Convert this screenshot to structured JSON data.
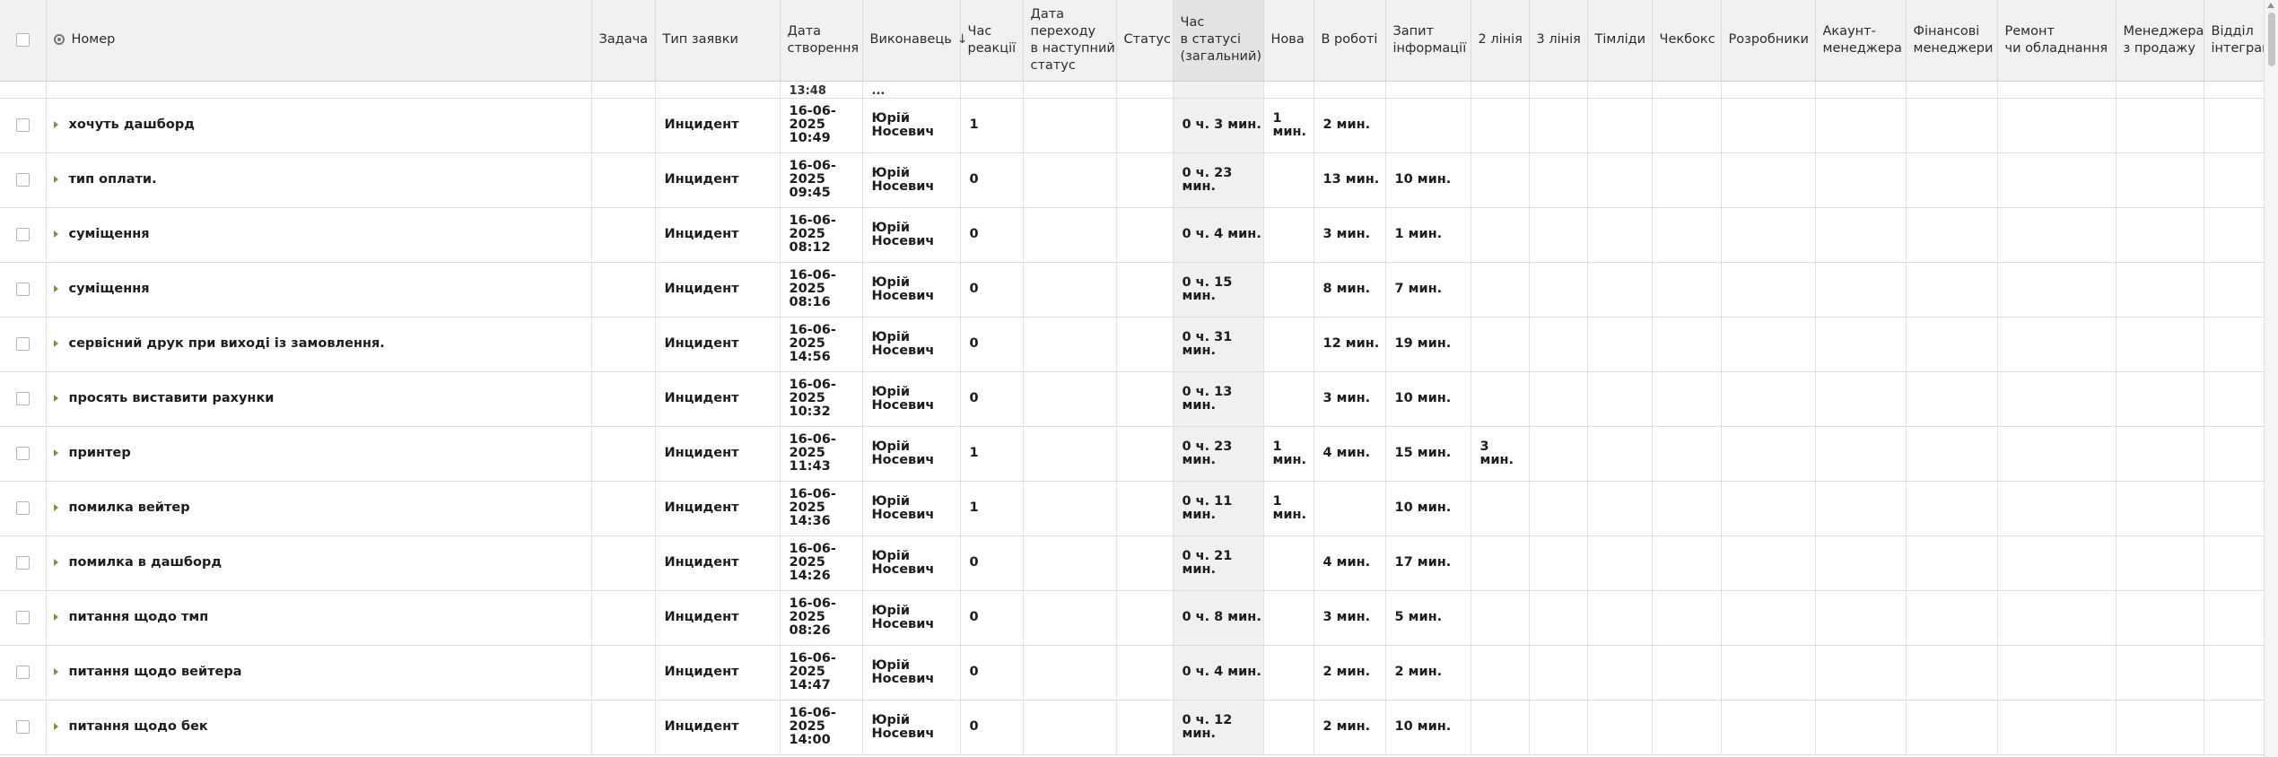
{
  "columns": [
    {
      "key": "number",
      "label": "Номер"
    },
    {
      "key": "task",
      "label": "Задача"
    },
    {
      "key": "type",
      "label": "Тип заявки"
    },
    {
      "key": "created",
      "label": "Дата\nстворення"
    },
    {
      "key": "assignee",
      "label": "Виконавець"
    },
    {
      "key": "reaction",
      "label": "Час\nреакції"
    },
    {
      "key": "next_status_date",
      "label": "Дата\nпереходу\nв наступний\nстатус"
    },
    {
      "key": "status",
      "label": "Статус"
    },
    {
      "key": "time_in_status",
      "label": "Час\nв статусі\n(загальний)"
    },
    {
      "key": "new",
      "label": "Нова"
    },
    {
      "key": "in_work",
      "label": "В роботі"
    },
    {
      "key": "info_request",
      "label": "Запит\nінформації"
    },
    {
      "key": "line2",
      "label": "2 лінія"
    },
    {
      "key": "line3",
      "label": "3 лінія"
    },
    {
      "key": "teamlead",
      "label": "Тімліди"
    },
    {
      "key": "checkbox",
      "label": "Чекбокс"
    },
    {
      "key": "developers",
      "label": "Розробники"
    },
    {
      "key": "account_managers",
      "label": "Акаунт-\nменеджера"
    },
    {
      "key": "finance_managers",
      "label": "Фінансові\nменеджери"
    },
    {
      "key": "repair",
      "label": "Ремонт\nчи обладнання"
    },
    {
      "key": "sales_managers",
      "label": "Менеджера\nз продажу"
    },
    {
      "key": "integration_dept",
      "label": "Відділ\nінтеграції"
    }
  ],
  "sort_indicator": "↓",
  "partial_row": {
    "created_fragment": "13:48",
    "assignee_fragment": "..."
  },
  "rows": [
    {
      "number": "хочуть дашборд",
      "type": "Инцидент",
      "created": "16-06-\n2025\n10:49",
      "assignee": "Юрій\nНосевич",
      "reaction": "1",
      "time_in_status": "0 ч. 3 мин.",
      "new": "1\nмин.",
      "in_work": "2 мин.",
      "info_request": "",
      "line2": ""
    },
    {
      "number": "тип оплати.",
      "type": "Инцидент",
      "created": "16-06-\n2025\n09:45",
      "assignee": "Юрій\nНосевич",
      "reaction": "0",
      "time_in_status": "0 ч. 23\nмин.",
      "new": "",
      "in_work": "13 мин.",
      "info_request": "10 мин.",
      "line2": ""
    },
    {
      "number": "суміщення",
      "type": "Инцидент",
      "created": "16-06-\n2025\n08:12",
      "assignee": "Юрій\nНосевич",
      "reaction": "0",
      "time_in_status": "0 ч. 4 мин.",
      "new": "",
      "in_work": "3 мин.",
      "info_request": "1 мин.",
      "line2": ""
    },
    {
      "number": "суміщення",
      "type": "Инцидент",
      "created": "16-06-\n2025\n08:16",
      "assignee": "Юрій\nНосевич",
      "reaction": "0",
      "time_in_status": "0 ч. 15\nмин.",
      "new": "",
      "in_work": "8 мин.",
      "info_request": "7 мин.",
      "line2": ""
    },
    {
      "number": "сервісний друк при виході із замовлення.",
      "type": "Инцидент",
      "created": "16-06-\n2025\n14:56",
      "assignee": "Юрій\nНосевич",
      "reaction": "0",
      "time_in_status": "0 ч. 31\nмин.",
      "new": "",
      "in_work": "12 мин.",
      "info_request": "19 мин.",
      "line2": ""
    },
    {
      "number": "просять виставити рахунки",
      "type": "Инцидент",
      "created": "16-06-\n2025\n10:32",
      "assignee": "Юрій\nНосевич",
      "reaction": "0",
      "time_in_status": "0 ч. 13\nмин.",
      "new": "",
      "in_work": "3 мин.",
      "info_request": "10 мин.",
      "line2": ""
    },
    {
      "number": "принтер",
      "type": "Инцидент",
      "created": "16-06-\n2025\n11:43",
      "assignee": "Юрій\nНосевич",
      "reaction": "1",
      "time_in_status": "0 ч. 23\nмин.",
      "new": "1\nмин.",
      "in_work": "4 мин.",
      "info_request": "15 мин.",
      "line2": "3\nмин."
    },
    {
      "number": "помилка вейтер",
      "type": "Инцидент",
      "created": "16-06-\n2025\n14:36",
      "assignee": "Юрій\nНосевич",
      "reaction": "1",
      "time_in_status": "0 ч. 11\nмин.",
      "new": "1\nмин.",
      "in_work": "",
      "info_request": "10 мин.",
      "line2": ""
    },
    {
      "number": "помилка в дашборд",
      "type": "Инцидент",
      "created": "16-06-\n2025\n14:26",
      "assignee": "Юрій\nНосевич",
      "reaction": "0",
      "time_in_status": "0 ч. 21\nмин.",
      "new": "",
      "in_work": "4 мин.",
      "info_request": "17 мин.",
      "line2": ""
    },
    {
      "number": "питання щодо тмп",
      "type": "Инцидент",
      "created": "16-06-\n2025\n08:26",
      "assignee": "Юрій\nНосевич",
      "reaction": "0",
      "time_in_status": "0 ч. 8 мин.",
      "new": "",
      "in_work": "3 мин.",
      "info_request": "5 мин.",
      "line2": ""
    },
    {
      "number": "питання щодо вейтера",
      "type": "Инцидент",
      "created": "16-06-\n2025\n14:47",
      "assignee": "Юрій\nНосевич",
      "reaction": "0",
      "time_in_status": "0 ч. 4 мин.",
      "new": "",
      "in_work": "2 мин.",
      "info_request": "2 мин.",
      "line2": ""
    },
    {
      "number": "питання щодо бек",
      "type": "Инцидент",
      "created": "16-06-\n2025\n14:00",
      "assignee": "Юрій\nНосевич",
      "reaction": "0",
      "time_in_status": "0 ч. 12\nмин.",
      "new": "",
      "in_work": "2 мин.",
      "info_request": "10 мин.",
      "line2": ""
    }
  ]
}
